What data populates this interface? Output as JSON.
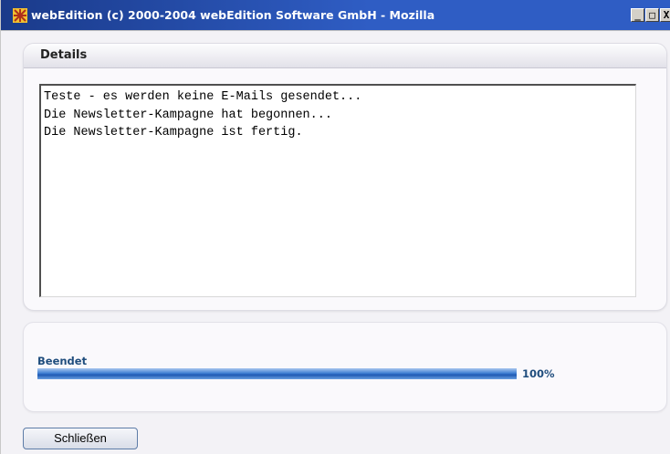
{
  "window": {
    "title": "webEdition (c) 2000-2004 webEdition Software GmbH - Mozilla",
    "icon": "webedition-icon",
    "controls": {
      "minimize": "_",
      "maximize": "□",
      "close": "X"
    }
  },
  "details": {
    "header": "Details",
    "log_lines": [
      "Teste - es werden keine E-Mails gesendet...",
      "Die Newsletter-Kampagne hat begonnen...",
      "Die Newsletter-Kampagne ist fertig."
    ]
  },
  "progress": {
    "label": "Beendet",
    "value_fraction": 1.0,
    "percent_text": "100%"
  },
  "actions": {
    "close_label": "Schließen"
  },
  "colors": {
    "titlebar": "#2f5dc4",
    "progress_text": "#1f4d7d",
    "progress_fill": "#3f7fd3"
  }
}
